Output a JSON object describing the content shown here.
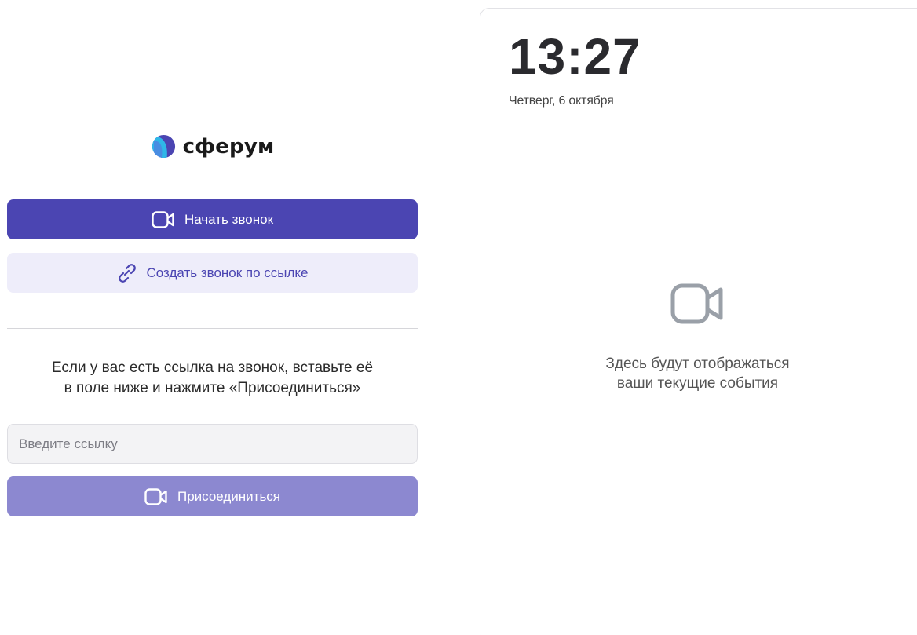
{
  "brand": {
    "name": "сферум",
    "logo_icon": "sferum-sphere-icon",
    "colors": {
      "sphere_main": "#4b45b2",
      "sphere_accent": "#2fb7e8"
    }
  },
  "actions": {
    "start_call_label": "Начать звонок",
    "start_call_icon": "video-camera-icon",
    "create_link_call_label": "Создать звонок по ссылке",
    "create_link_call_icon": "link-icon"
  },
  "join": {
    "hint_line1": "Если у вас есть ссылка на звонок, вставьте её",
    "hint_line2": "в поле ниже и нажмите «Присоединиться»",
    "input_placeholder": "Введите ссылку",
    "input_value": "",
    "join_label": "Присоединиться",
    "join_icon": "video-camera-icon"
  },
  "events_panel": {
    "time": "13:27",
    "date": "Четверг, 6 октября",
    "empty_icon": "video-camera-icon",
    "empty_line1": "Здесь будут отображаться",
    "empty_line2": "ваши текущие события"
  },
  "colors": {
    "primary": "#4b45b2",
    "secondary_bg": "#eeedfa",
    "join_disabled": "#8c88d0",
    "input_bg": "#f3f3f5",
    "icon_muted": "#9aa0a8"
  }
}
